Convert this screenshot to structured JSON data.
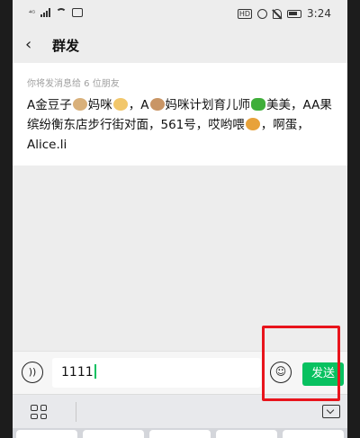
{
  "status_bar": {
    "left_indicator": "⁴ᴳ",
    "hd_label": "HD",
    "time": "3:24"
  },
  "nav": {
    "back_icon": "chevron-left",
    "title": "群发"
  },
  "recipients": {
    "hint": "你将发消息给 6 位朋友",
    "names": [
      {
        "text": "A金豆子",
        "emoji": "dog-face-emoji"
      },
      {
        "text": "妈咪",
        "emoji": "woman-emoji"
      },
      {
        "text": "，A",
        "emoji": "monkey-face-emoji"
      },
      {
        "text": "妈咪计划育儿师",
        "emoji": "four-leaf-clover-emoji"
      },
      {
        "text": "美美，AA果缤纷衡东店步行街对面，561号，哎哟喂",
        "emoji": "lion-face-emoji"
      },
      {
        "text": "，啊蛋，Alice.li",
        "emoji": ""
      }
    ]
  },
  "input_bar": {
    "voice_icon": "voice-icon",
    "value": "1111",
    "emoji_icon": "smiley-icon",
    "send_label": "发送"
  },
  "colors": {
    "send_bg": "#07c160",
    "highlight": "#e8141c",
    "card_bg": "#ffffff",
    "page_bg": "#ededed"
  },
  "keyboard_bar": {
    "left_icon": "grid-icon",
    "right_icon": "keyboard-hide-icon"
  }
}
